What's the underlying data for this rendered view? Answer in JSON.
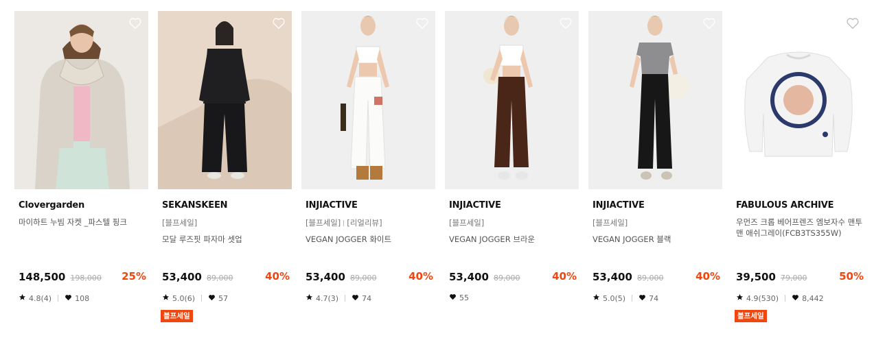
{
  "icons": {
    "wish": "heart-outline-icon",
    "rating": "star-icon",
    "likes": "heart-filled-icon"
  },
  "colors": {
    "discount": "#f0460f",
    "badge_bg": "#f0460f"
  },
  "products": [
    {
      "brand": "Clovergarden",
      "tags": [],
      "name": "마이하트 누빔 자켓 _파스텔 핑크",
      "price": "148,500",
      "original_price": "198,000",
      "discount": "25%",
      "rating": "4.8(4)",
      "likes": "108",
      "badge": ""
    },
    {
      "brand": "SEKANSKEEN",
      "tags": [
        "[블프세일]"
      ],
      "name": "모달 루즈핏 파자마 셋업",
      "price": "53,400",
      "original_price": "89,000",
      "discount": "40%",
      "rating": "5.0(6)",
      "likes": "57",
      "badge": "블프세일"
    },
    {
      "brand": "INJIACTIVE",
      "tags": [
        "[블프세일]",
        "[리얼리뷰]"
      ],
      "name": "VEGAN JOGGER 화이트",
      "price": "53,400",
      "original_price": "89,000",
      "discount": "40%",
      "rating": "4.7(3)",
      "likes": "74",
      "badge": ""
    },
    {
      "brand": "INJIACTIVE",
      "tags": [
        "[블프세일]"
      ],
      "name": "VEGAN JOGGER 브라운",
      "price": "53,400",
      "original_price": "89,000",
      "discount": "40%",
      "rating": "",
      "likes": "55",
      "badge": ""
    },
    {
      "brand": "INJIACTIVE",
      "tags": [
        "[블프세일]"
      ],
      "name": "VEGAN JOGGER 블랙",
      "price": "53,400",
      "original_price": "89,000",
      "discount": "40%",
      "rating": "5.0(5)",
      "likes": "74",
      "badge": ""
    },
    {
      "brand": "FABULOUS ARCHIVE",
      "tags": [],
      "name": "우먼즈 크롭 베어프렌즈 엠보자수 맨투맨 애쉬그레이(FCB3TS355W)",
      "price": "39,500",
      "original_price": "79,000",
      "discount": "50%",
      "rating": "4.9(530)",
      "likes": "8,442",
      "badge": "블프세일"
    }
  ]
}
